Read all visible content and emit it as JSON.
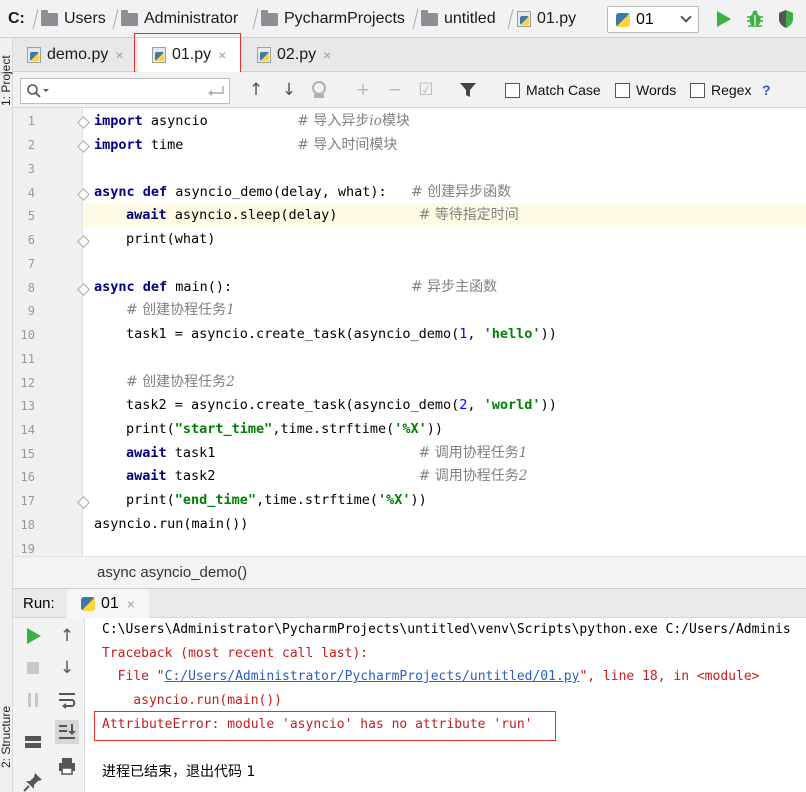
{
  "navbar": {
    "drive": "C:",
    "crumbs": [
      "Users",
      "Administrator",
      "PycharmProjects",
      "untitled",
      "01.py"
    ],
    "run_config": "01"
  },
  "left_strip": {
    "project_label": "1: Project",
    "structure_label": "2: Structure"
  },
  "tabs": [
    {
      "label": "demo.py",
      "close": "×"
    },
    {
      "label": "01.py",
      "close": "×"
    },
    {
      "label": "02.py",
      "close": "×"
    }
  ],
  "search": {
    "value": "",
    "options": {
      "match_case": "Match Case",
      "words": "Words",
      "regex": "Regex",
      "help": "?"
    }
  },
  "editor": {
    "line_numbers": [
      "1",
      "2",
      "3",
      "4",
      "5",
      "6",
      "7",
      "8",
      "9",
      "10",
      "11",
      "12",
      "13",
      "14",
      "15",
      "16",
      "17",
      "18",
      "19"
    ],
    "lines": {
      "l1": {
        "kw": "import",
        "code": " asyncio           ",
        "comment": "# 导入异步",
        "comment_i": "io",
        "comment2": "模块"
      },
      "l2": {
        "kw": "import",
        "code": " time              ",
        "comment": "# 导入时间模块"
      },
      "l4": {
        "kw": "async def",
        "code": " asyncio_demo(delay, what):   ",
        "comment": "# 创建异步函数"
      },
      "l5": {
        "kw": "await",
        "code": " asyncio.sleep(delay)          ",
        "comment": "# 等待指定时间"
      },
      "l6": {
        "code": "print(what)"
      },
      "l8": {
        "kw": "async def",
        "code": " main():                      ",
        "comment": "# 异步主函数"
      },
      "l9": {
        "comment": "# 创建协程任务",
        "comment_i": "1"
      },
      "l10": {
        "code": "task1 = asyncio.create_task(asyncio_demo(",
        "num": "1",
        "code2": ", ",
        "str": "'hello'",
        "code3": "))"
      },
      "l12": {
        "comment": "# 创建协程任务",
        "comment_i": "2"
      },
      "l13": {
        "code": "task2 = asyncio.create_task(asyncio_demo(",
        "num": "2",
        "code2": ", ",
        "str": "'world'",
        "code3": "))"
      },
      "l14": {
        "code": "print(",
        "str": "\"start_time\"",
        "code2": ",time.strftime(",
        "str2": "'%X'",
        "code3": "))"
      },
      "l15": {
        "kw": "await",
        "code": " task1                         ",
        "comment": "# 调用协程任务",
        "comment_i": "1"
      },
      "l16": {
        "kw": "await",
        "code": " task2                         ",
        "comment": "# 调用协程任务",
        "comment_i": "2"
      },
      "l17": {
        "code": "print(",
        "str": "\"end_time\"",
        "code2": ",time.strftime(",
        "str2": "'%X'",
        "code3": "))"
      },
      "l18": {
        "code": "asyncio.run(main())"
      }
    }
  },
  "breadcrumb": "async asyncio_demo()",
  "run": {
    "title": "Run:",
    "tab_label": "01",
    "tab_close": "×",
    "console": {
      "cmd": "C:\\Users\\Administrator\\PycharmProjects\\untitled\\venv\\Scripts\\python.exe C:/Users/Adminis",
      "traceback": "Traceback (most recent call last):",
      "file_prefix": "  File \"",
      "file_link": "C:/Users/Administrator/PycharmProjects/untitled/01.py",
      "file_suffix": "\", line 18, in <module>",
      "code": "    asyncio.run(main())",
      "error": "AttributeError: module 'asyncio' has no attribute 'run'",
      "exit": "进程已结束，退出代码 1"
    }
  },
  "colors": {
    "keyword": "#000080",
    "string": "#008000",
    "comment": "#808080",
    "error": "#c41c1c",
    "link": "#2a5dc8",
    "highlight_box": "#e03030",
    "run_green": "#3cb043"
  }
}
